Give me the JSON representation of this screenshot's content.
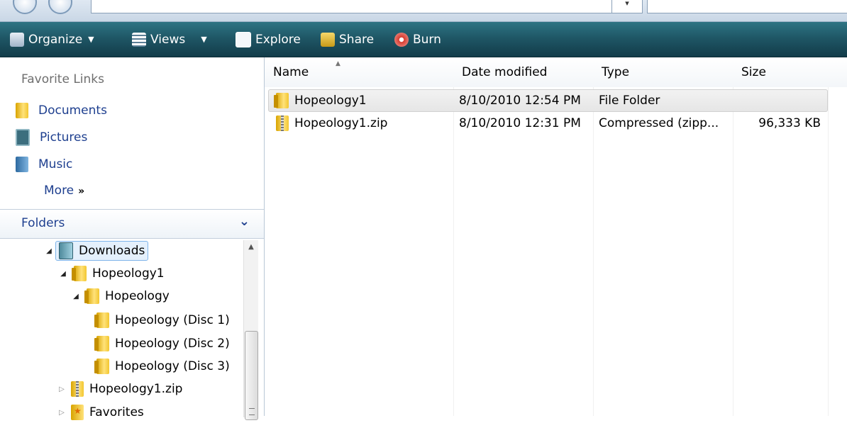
{
  "toolbar": {
    "organize": "Organize",
    "views": "Views",
    "explore": "Explore",
    "share": "Share",
    "burn": "Burn"
  },
  "favorites": {
    "header": "Favorite Links",
    "items": [
      "Documents",
      "Pictures",
      "Music"
    ],
    "more": "More",
    "more_chevron": "»"
  },
  "folders": {
    "header": "Folders",
    "tree": [
      {
        "label": "Downloads",
        "expanded": true,
        "selected": true
      },
      {
        "label": "Hopeology1",
        "expanded": true
      },
      {
        "label": "Hopeology",
        "expanded": true
      },
      {
        "label": "Hopeology (Disc 1)"
      },
      {
        "label": "Hopeology (Disc 2)"
      },
      {
        "label": "Hopeology (Disc 3)"
      },
      {
        "label": "Hopeology1.zip",
        "expanded": false
      },
      {
        "label": "Favorites",
        "expanded": false
      }
    ]
  },
  "columns": {
    "name": "Name",
    "date": "Date modified",
    "type": "Type",
    "size": "Size"
  },
  "files": [
    {
      "name": "Hopeology1",
      "date": "8/10/2010 12:54 PM",
      "type": "File Folder",
      "size": "",
      "icon": "folder-icon"
    },
    {
      "name": "Hopeology1.zip",
      "date": "8/10/2010 12:31 PM",
      "type": "Compressed (zipp...",
      "size": "96,333 KB",
      "icon": "zip-icon"
    }
  ],
  "colors": {
    "toolbar": "#1f5766",
    "link": "#1e3f8f",
    "selection": "#e4f0fc"
  }
}
